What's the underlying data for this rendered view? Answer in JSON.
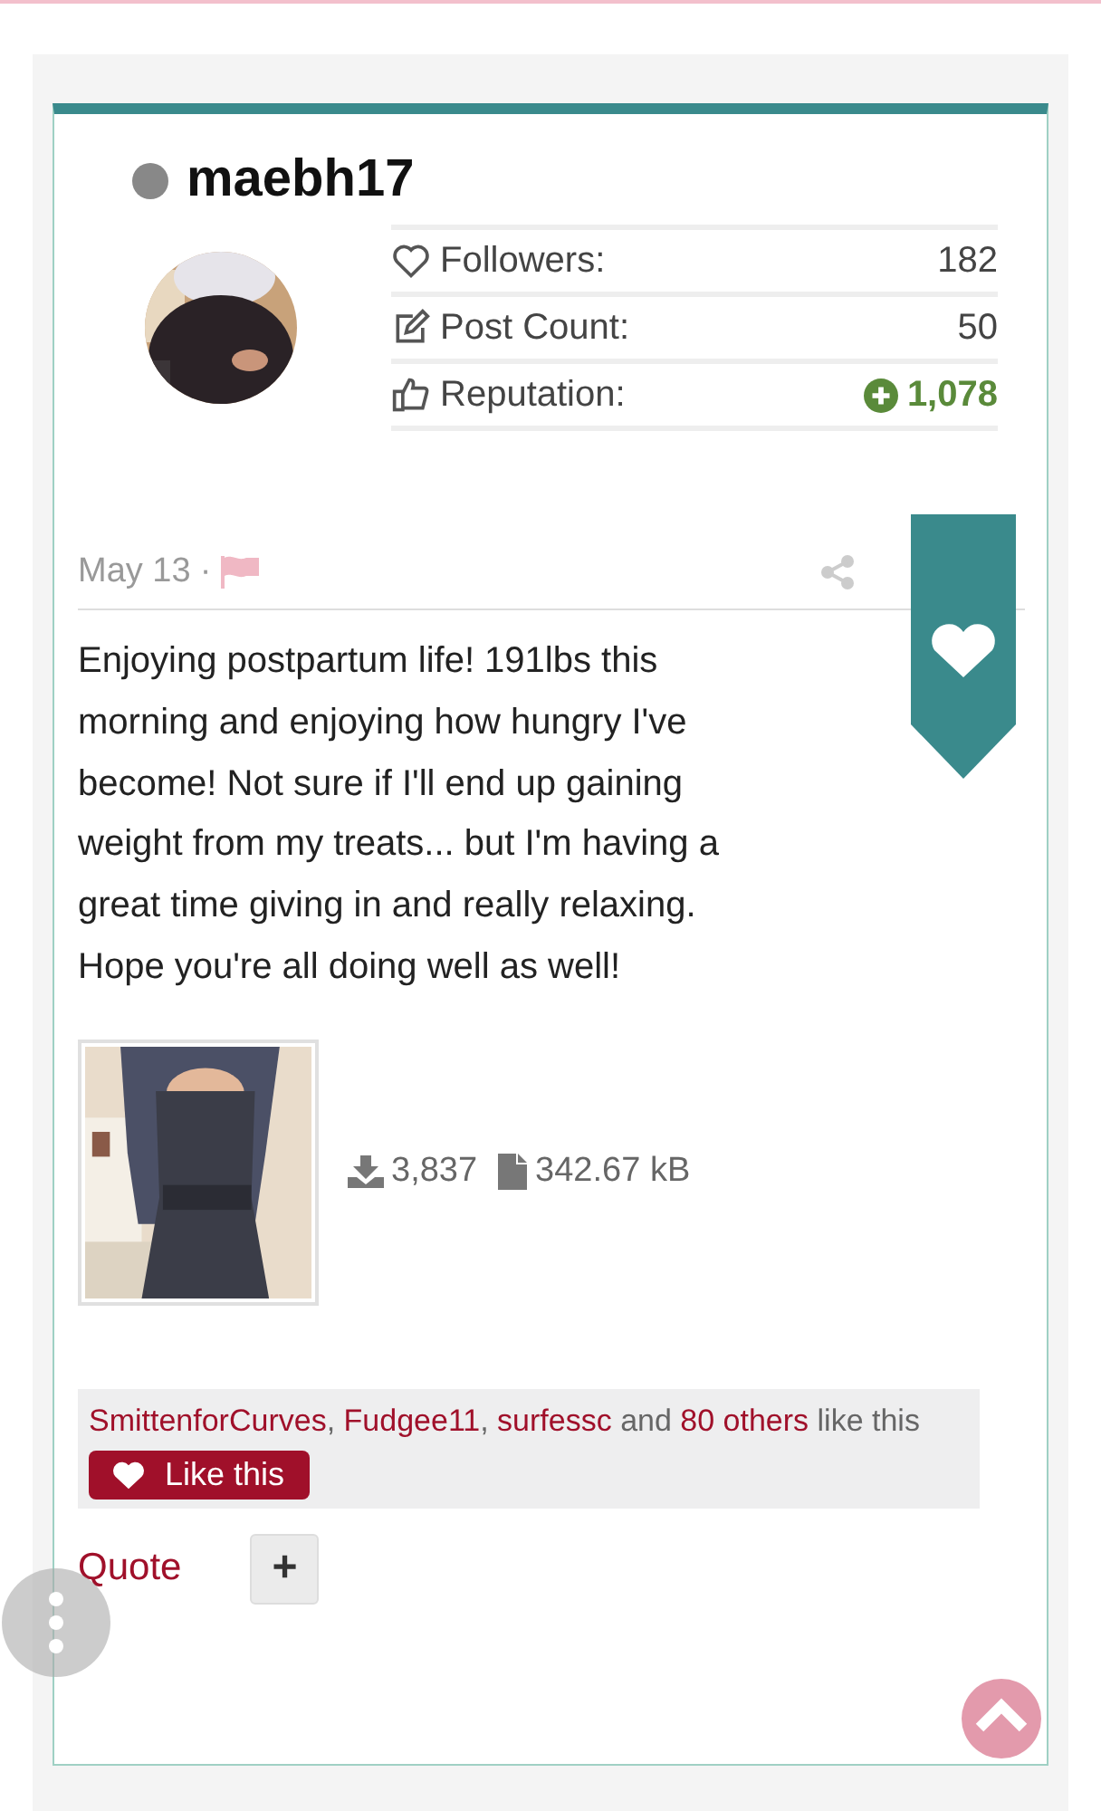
{
  "user": {
    "name": "maebh17",
    "online": false,
    "stats": [
      {
        "kind": "followers",
        "label": "Followers:",
        "value": "182"
      },
      {
        "kind": "posts",
        "label": "Post Count:",
        "value": "50"
      },
      {
        "kind": "reputation",
        "label": "Reputation:",
        "value": "1,078"
      }
    ]
  },
  "post": {
    "date": "May 13",
    "separator": "·",
    "bookmarked": true,
    "text": "Enjoying postpartum life! 191lbs this morning and enjoying how hungry I've become! Not sure if I'll end up gaining weight from my treats... but I'm having a great time giving in and really relaxing. Hope you're all doing well as well!",
    "attachment": {
      "kind": "picture",
      "downloads": "3,837",
      "size": "342.67 kB"
    },
    "likes": {
      "users": [
        "SmittenforCurves",
        "Fudgee11",
        "surfessc"
      ],
      "separator": ",",
      "connector": "and",
      "others": "80 others",
      "suffix": "like this",
      "button": "Like this"
    },
    "actions": {
      "quote": "Quote",
      "more": "+"
    }
  }
}
